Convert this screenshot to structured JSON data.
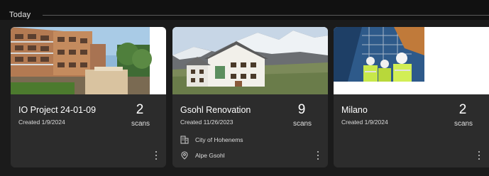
{
  "section": {
    "title": "Today"
  },
  "projects": [
    {
      "title": "IO Project 24-01-09",
      "created": "Created 1/9/2024",
      "scan_count": "2",
      "scan_label": "scans",
      "thumbnail_icon": "apartment-building-photo"
    },
    {
      "title": "Gsohl Renovation",
      "created": "Created 11/26/2023",
      "scan_count": "9",
      "scan_label": "scans",
      "organization": "City of Hohenems",
      "location": "Alpe Gsohl",
      "thumbnail_icon": "mountain-hut-photo"
    },
    {
      "title": "Milano",
      "created": "Created 1/9/2024",
      "scan_count": "2",
      "scan_label": "scans",
      "thumbnail_icon": "construction-workers-photo"
    }
  ],
  "colors": {
    "background": "#1b1b1b",
    "header": "#111111",
    "card": "#2c2c2c",
    "text": "#ffffff",
    "secondary_text": "#dcdcdc"
  }
}
